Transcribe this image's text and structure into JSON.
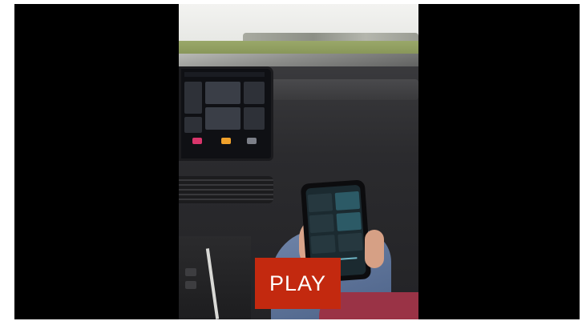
{
  "player": {
    "play_label": "PLAY",
    "play_color": "#c3290f",
    "background_color": "#000000"
  },
  "video": {
    "frame_icon": "video-frame-image"
  }
}
